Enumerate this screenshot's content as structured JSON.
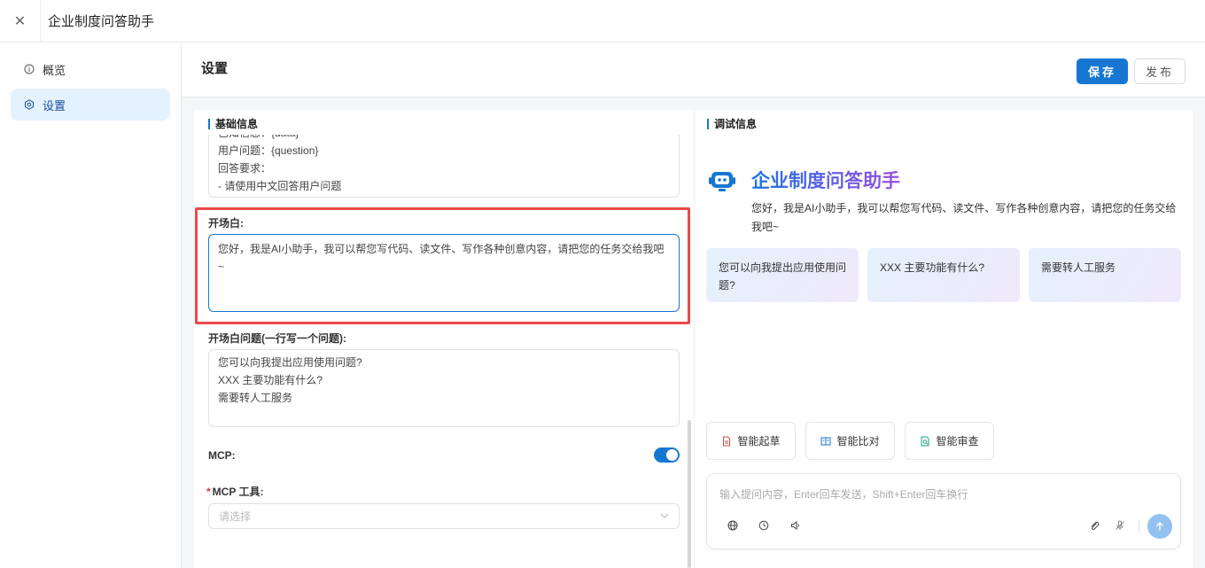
{
  "topbar": {
    "title": "企业制度问答助手"
  },
  "sidebar": {
    "items": [
      {
        "label": "概览",
        "icon": "info-icon",
        "active": false
      },
      {
        "label": "设置",
        "icon": "gear-icon",
        "active": true
      }
    ]
  },
  "header": {
    "title": "设置",
    "save_label": "保存",
    "publish_label": "发布"
  },
  "basic": {
    "section_title": "基础信息",
    "prompt_lines": [
      "已知信息：{data}",
      "用户问题：{question}",
      "回答要求：",
      "- 请使用中文回答用户问题"
    ],
    "opening_label": "开场白:",
    "opening_text": "您好，我是AI小助手，我可以帮您写代码、读文件、写作各种创意内容，请把您的任务交给我吧~",
    "questions_label": "开场白问题(一行写一个问题):",
    "questions": [
      "您可以向我提出应用使用问题?",
      "XXX 主要功能有什么?",
      "需要转人工服务"
    ],
    "mcp_label": "MCP:",
    "mcp_enabled": true,
    "mcp_tools_required": "*",
    "mcp_tools_label": "MCP 工具:",
    "mcp_tools_placeholder": "请选择"
  },
  "debug": {
    "section_title": "调试信息",
    "bot_title": "企业制度问答助手",
    "greeting": "您好，我是AI小助手，我可以帮您写代码、读文件、写作各种创意内容，请把您的任务交给我吧~",
    "suggestions": [
      "您可以向我提出应用使用问题?",
      "XXX 主要功能有什么?",
      "需要转人工服务"
    ],
    "actions": [
      {
        "label": "智能起草",
        "icon": "document-icon"
      },
      {
        "label": "智能比对",
        "icon": "compare-icon"
      },
      {
        "label": "智能审查",
        "icon": "review-icon"
      }
    ],
    "input_placeholder": "输入提问内容，Enter回车发送，Shift+Enter回车换行"
  },
  "colors": {
    "primary": "#1677d2",
    "highlight": "#e84a4a"
  }
}
